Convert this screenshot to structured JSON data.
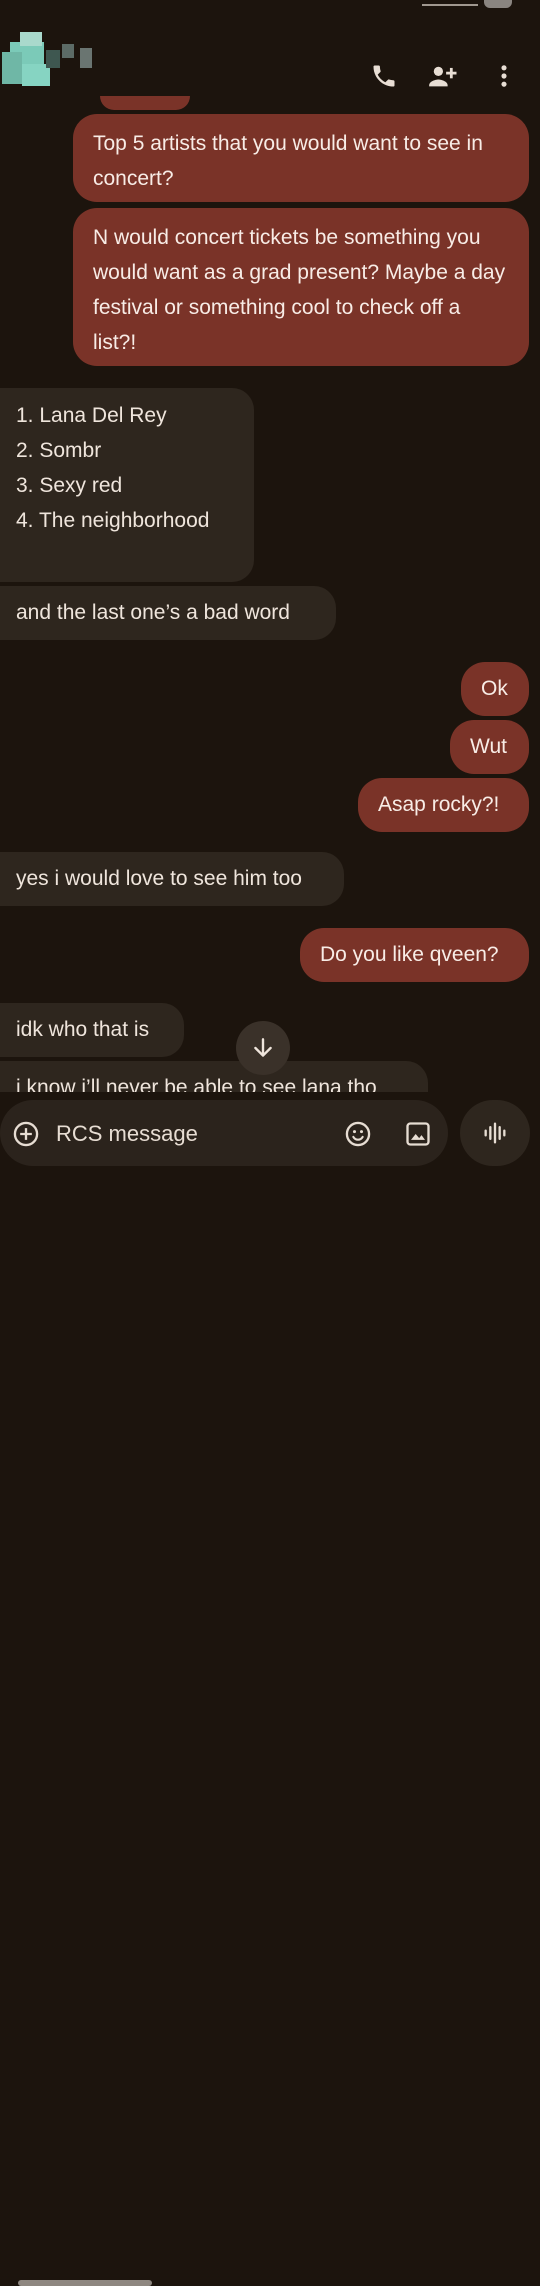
{
  "header": {
    "call_icon": "phone-icon",
    "add_contact_icon": "add-person-icon",
    "more_icon": "more-vertical-icon"
  },
  "messages": [
    {
      "direction": "out",
      "text": "Top 5 artists that you would want to see in concert?"
    },
    {
      "direction": "out",
      "text": "N would concert tickets be something you would want as a grad present? Maybe a day festival or something cool to check off a list?!"
    },
    {
      "direction": "in",
      "lines": [
        "1. Lana Del Rey",
        "2. Sombr",
        "3. Sexy red",
        "4. The neighborhood"
      ]
    },
    {
      "direction": "in",
      "text": "and the last one’s a bad word"
    },
    {
      "direction": "out",
      "text": "Ok"
    },
    {
      "direction": "out",
      "text": "Wut"
    },
    {
      "direction": "out",
      "text": "Asap rocky?!"
    },
    {
      "direction": "in",
      "text": "yes i would love to see him too"
    },
    {
      "direction": "out",
      "text": "Do you like qveen?"
    },
    {
      "direction": "in",
      "text": "idk who that is"
    },
    {
      "direction": "in",
      "text": "i know i’ll never be able to see lana tho"
    }
  ],
  "composer": {
    "placeholder": "RCS message",
    "add_icon": "add-circle-icon",
    "emoji_icon": "emoji-icon",
    "gallery_icon": "gallery-icon",
    "voice_icon": "voice-waveform-icon"
  },
  "scroll_down_icon": "arrow-down-icon",
  "colors": {
    "background": "#1c140d",
    "outgoing_bubble": "#7a3328",
    "incoming_bubble": "#2e261e",
    "text": "#f1e6dc"
  }
}
